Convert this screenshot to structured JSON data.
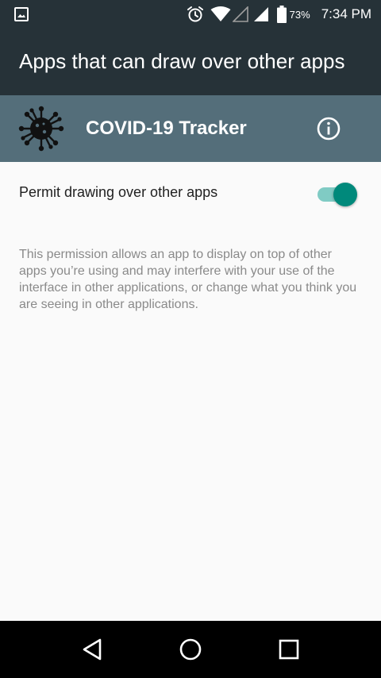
{
  "status_bar": {
    "battery_percent": "73%",
    "time": "7:34 PM",
    "icons": [
      "image-notification-icon",
      "alarm-icon",
      "wifi-icon",
      "signal-empty-icon",
      "signal-icon",
      "battery-icon"
    ]
  },
  "toolbar": {
    "title": "Apps that can draw over other apps"
  },
  "app": {
    "name": "COVID-19 Tracker",
    "icon": "virus-icon",
    "info_icon": "info-icon"
  },
  "permission": {
    "label": "Permit drawing over other apps",
    "enabled": true,
    "description": "This permission allows an app to display on top of other apps you’re using and may interfere with your use of the interface in other applications, or change what you think you are seeing in other applications."
  },
  "nav_bar": {
    "buttons": [
      "back-icon",
      "home-icon",
      "recents-icon"
    ]
  },
  "colors": {
    "toolbar": "#263238",
    "app_header": "#546e7a",
    "accent": "#00897b",
    "accent_track": "#80cbc4",
    "background": "#fafafa",
    "description_text": "#8a8a8a"
  }
}
